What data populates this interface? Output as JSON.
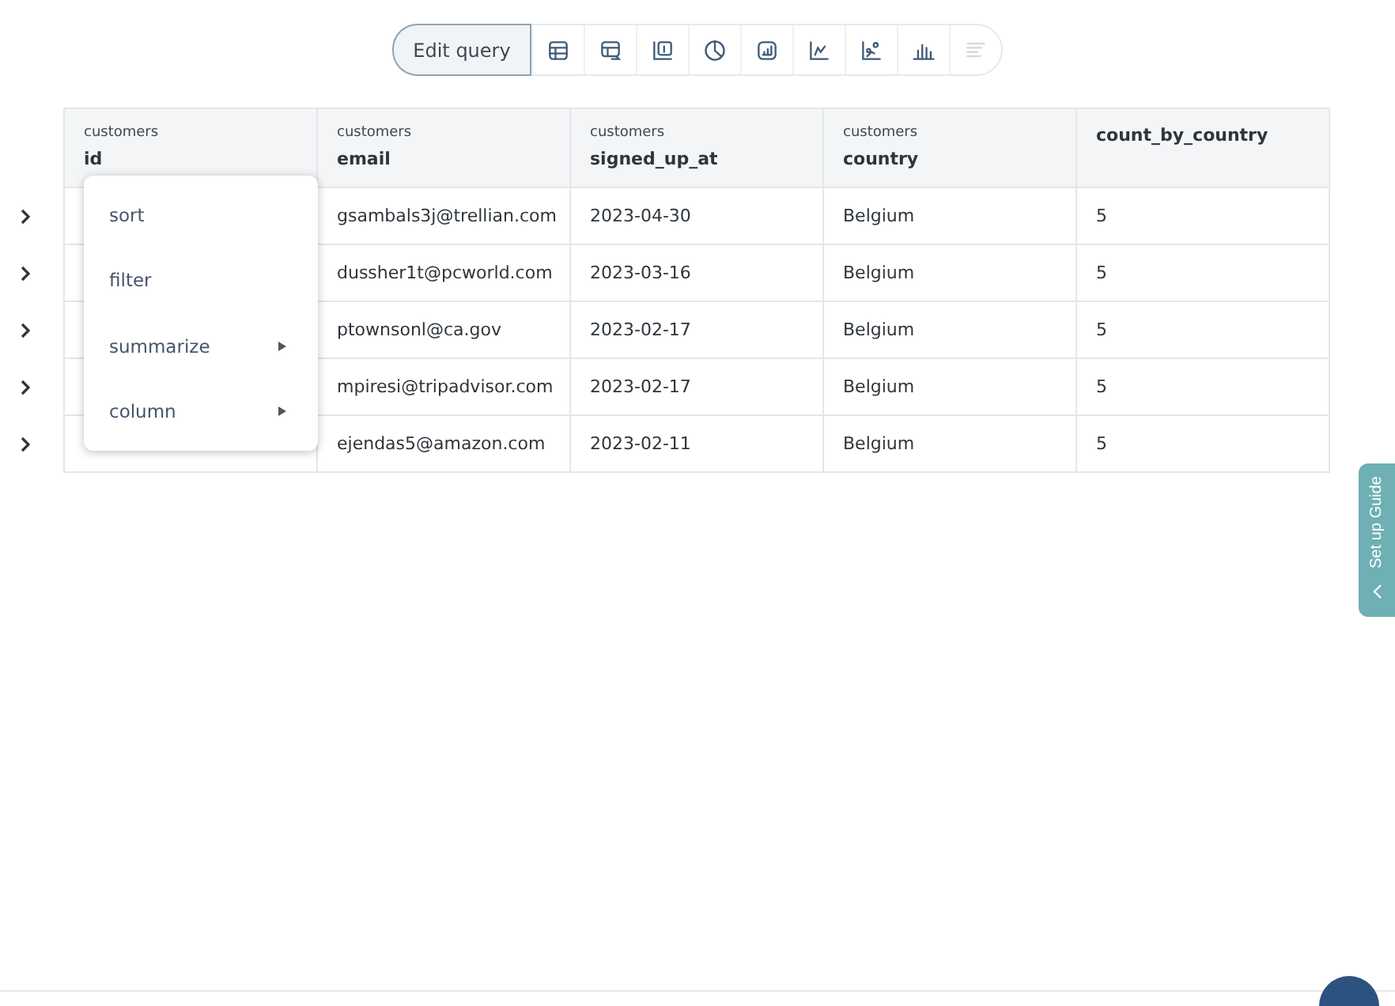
{
  "toolbar": {
    "edit_button": "Edit query",
    "views": [
      {
        "kind": "table",
        "disabled": false
      },
      {
        "kind": "pivot",
        "disabled": false
      },
      {
        "kind": "number",
        "disabled": false
      },
      {
        "kind": "pie",
        "disabled": false
      },
      {
        "kind": "progress",
        "disabled": false
      },
      {
        "kind": "line",
        "disabled": false
      },
      {
        "kind": "scatter",
        "disabled": false
      },
      {
        "kind": "bar",
        "disabled": false
      },
      {
        "kind": "row",
        "disabled": true
      }
    ]
  },
  "table": {
    "columns": [
      {
        "source": "customers",
        "name": "id"
      },
      {
        "source": "customers",
        "name": "email"
      },
      {
        "source": "customers",
        "name": "signed_up_at"
      },
      {
        "source": "customers",
        "name": "country"
      },
      {
        "name": "count_by_country"
      }
    ],
    "rows": [
      [
        "",
        "gsambals3j@trellian.com",
        "2023-04-30",
        "Belgium",
        "5"
      ],
      [
        "",
        "dussher1t@pcworld.com",
        "2023-03-16",
        "Belgium",
        "5"
      ],
      [
        "",
        "ptownsonl@ca.gov",
        "2023-02-17",
        "Belgium",
        "5"
      ],
      [
        "",
        "mpiresi@tripadvisor.com",
        "2023-02-17",
        "Belgium",
        "5"
      ],
      [
        "",
        "ejendas5@amazon.com",
        "2023-02-11",
        "Belgium",
        "5"
      ]
    ]
  },
  "column_menu": [
    {
      "label": "sort",
      "submenu": false
    },
    {
      "label": "filter",
      "submenu": false
    },
    {
      "label": "summarize",
      "submenu": true
    },
    {
      "label": "column",
      "submenu": true
    }
  ],
  "guide_tab": {
    "label": "Set up Guide"
  }
}
